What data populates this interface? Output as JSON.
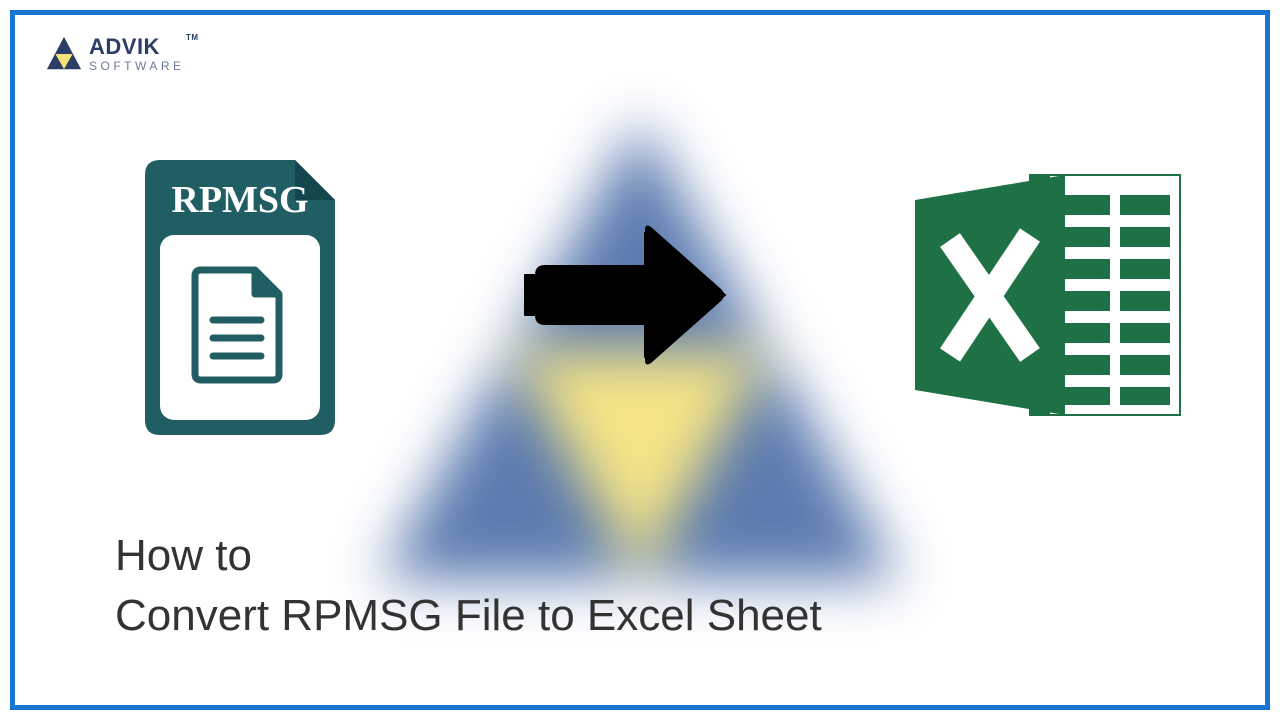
{
  "logo": {
    "brand": "ADVIK",
    "subtitle": "SOFTWARE",
    "tm": "TM"
  },
  "icons": {
    "rpmsg_label": "RPMSG",
    "arrow": "arrow-right",
    "excel_letter": "X"
  },
  "title": {
    "line1": "How to",
    "line2": "Convert RPMSG File to Excel Sheet"
  }
}
